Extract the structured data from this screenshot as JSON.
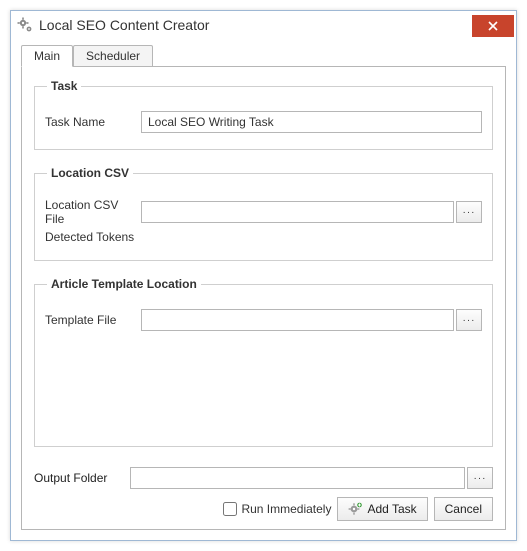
{
  "window": {
    "title": "Local SEO Content Creator"
  },
  "tabs": {
    "main": "Main",
    "scheduler": "Scheduler"
  },
  "groups": {
    "task": {
      "legend": "Task",
      "taskNameLabel": "Task Name",
      "taskNameValue": "Local SEO Writing Task"
    },
    "locationCsv": {
      "legend": "Location CSV",
      "fileLabel": "Location CSV File",
      "fileValue": "",
      "tokensLabel": "Detected Tokens"
    },
    "template": {
      "legend": "Article Template Location",
      "fileLabel": "Template File",
      "fileValue": ""
    }
  },
  "output": {
    "label": "Output Folder",
    "value": ""
  },
  "footer": {
    "runImmediately": "Run Immediately",
    "addTask": "Add Task",
    "cancel": "Cancel"
  },
  "browseGlyph": "···"
}
